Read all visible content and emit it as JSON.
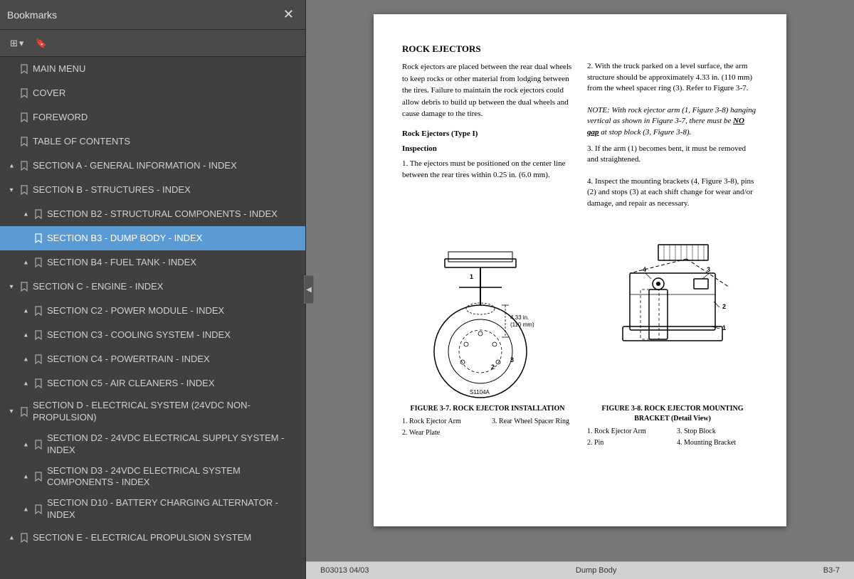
{
  "sidebar": {
    "title": "Bookmarks",
    "close_label": "✕",
    "toolbar": {
      "expand_btn": "⊞▾",
      "bookmark_btn": "🔖"
    },
    "items": [
      {
        "id": "main-menu",
        "label": "MAIN MENU",
        "level": 0,
        "expand": "none",
        "active": false
      },
      {
        "id": "cover",
        "label": "COVER",
        "level": 0,
        "expand": "none",
        "active": false
      },
      {
        "id": "foreword",
        "label": "FOREWORD",
        "level": 0,
        "expand": "none",
        "active": false
      },
      {
        "id": "toc",
        "label": "TABLE OF CONTENTS",
        "level": 0,
        "expand": "none",
        "active": false
      },
      {
        "id": "section-a",
        "label": "SECTION A - GENERAL INFORMATION - INDEX",
        "level": 0,
        "expand": "collapsed",
        "active": false
      },
      {
        "id": "section-b",
        "label": "SECTION B - STRUCTURES - INDEX",
        "level": 0,
        "expand": "expanded",
        "active": false
      },
      {
        "id": "section-b2",
        "label": "SECTION B2 - STRUCTURAL COMPONENTS - INDEX",
        "level": 1,
        "expand": "collapsed",
        "active": false
      },
      {
        "id": "section-b3",
        "label": "SECTION B3 - DUMP BODY - INDEX",
        "level": 1,
        "expand": "none",
        "active": true
      },
      {
        "id": "section-b4",
        "label": "SECTION B4 - FUEL TANK - INDEX",
        "level": 1,
        "expand": "collapsed",
        "active": false
      },
      {
        "id": "section-c",
        "label": "SECTION C - ENGINE - INDEX",
        "level": 0,
        "expand": "expanded",
        "active": false
      },
      {
        "id": "section-c2",
        "label": "SECTION C2 - POWER MODULE - INDEX",
        "level": 1,
        "expand": "collapsed",
        "active": false
      },
      {
        "id": "section-c3",
        "label": "SECTION C3 - COOLING SYSTEM - INDEX",
        "level": 1,
        "expand": "collapsed",
        "active": false
      },
      {
        "id": "section-c4",
        "label": "SECTION C4 - POWERTRAIN - INDEX",
        "level": 1,
        "expand": "collapsed",
        "active": false
      },
      {
        "id": "section-c5",
        "label": "SECTION C5 - AIR CLEANERS - INDEX",
        "level": 1,
        "expand": "collapsed",
        "active": false
      },
      {
        "id": "section-d",
        "label": "SECTION D - ELECTRICAL SYSTEM (24VDC NON-PROPULSION)",
        "level": 0,
        "expand": "expanded",
        "active": false
      },
      {
        "id": "section-d2",
        "label": "SECTION D2 - 24VDC ELECTRICAL SUPPLY SYSTEM - INDEX",
        "level": 1,
        "expand": "collapsed",
        "active": false
      },
      {
        "id": "section-d3",
        "label": "SECTION D3 - 24VDC ELECTRICAL SYSTEM COMPONENTS - INDEX",
        "level": 1,
        "expand": "collapsed",
        "active": false
      },
      {
        "id": "section-d10",
        "label": "SECTION D10 - BATTERY CHARGING ALTERNATOR - INDEX",
        "level": 1,
        "expand": "collapsed",
        "active": false
      },
      {
        "id": "section-e",
        "label": "SECTION E - ELECTRICAL PROPULSION SYSTEM",
        "level": 0,
        "expand": "collapsed",
        "active": false
      }
    ]
  },
  "document": {
    "section_title": "ROCK EJECTORS",
    "intro": "Rock ejectors are placed between the rear dual wheels to keep rocks or other material from lodging between the tires. Failure to maintain the rock ejectors could allow debris to build up between the dual wheels and cause damage to the tires.",
    "type_label": "Rock Ejectors (Type I)",
    "inspection_label": "Inspection",
    "left_column": {
      "items": [
        "1. The ejectors must be positioned on the center line between the rear tires within 0.25 in. (6.0 mm)."
      ]
    },
    "right_column": {
      "items": [
        "2. With the truck parked on a level surface, the arm structure should be approximately 4.33 in. (110 mm) from the wheel spacer ring (3). Refer to Figure 3-7.",
        "NOTE: With rock ejector arm (1, Figure 3-8) hanging vertical as shown in Figure 3-7, there must be NO gap at stop block (3, Figure 3-8).",
        "3. If the arm (1) becomes bent, it must be removed and straightened.",
        "4. Inspect the mounting brackets (4, Figure 3-8), pins (2) and stops (3) at each shift change for wear and/or damage, and repair as necessary."
      ]
    },
    "figure1": {
      "caption": "FIGURE 3-7. ROCK EJECTOR INSTALLATION",
      "id_label": "S1104A",
      "legend": [
        "1. Rock Ejector Arm",
        "3. Rear Wheel Spacer Ring",
        "2. Wear Plate",
        ""
      ]
    },
    "figure2": {
      "caption": "FIGURE 3-8. ROCK EJECTOR MOUNTING BRACKET (Detail View)",
      "legend": [
        "1. Rock Ejector Arm",
        "3. Stop Block",
        "2. Pin",
        "4. Mounting Bracket"
      ]
    },
    "footer": {
      "left": "B03013  04/03",
      "center": "Dump Body",
      "right": "B3-7"
    }
  },
  "collapse_arrow": "◀"
}
